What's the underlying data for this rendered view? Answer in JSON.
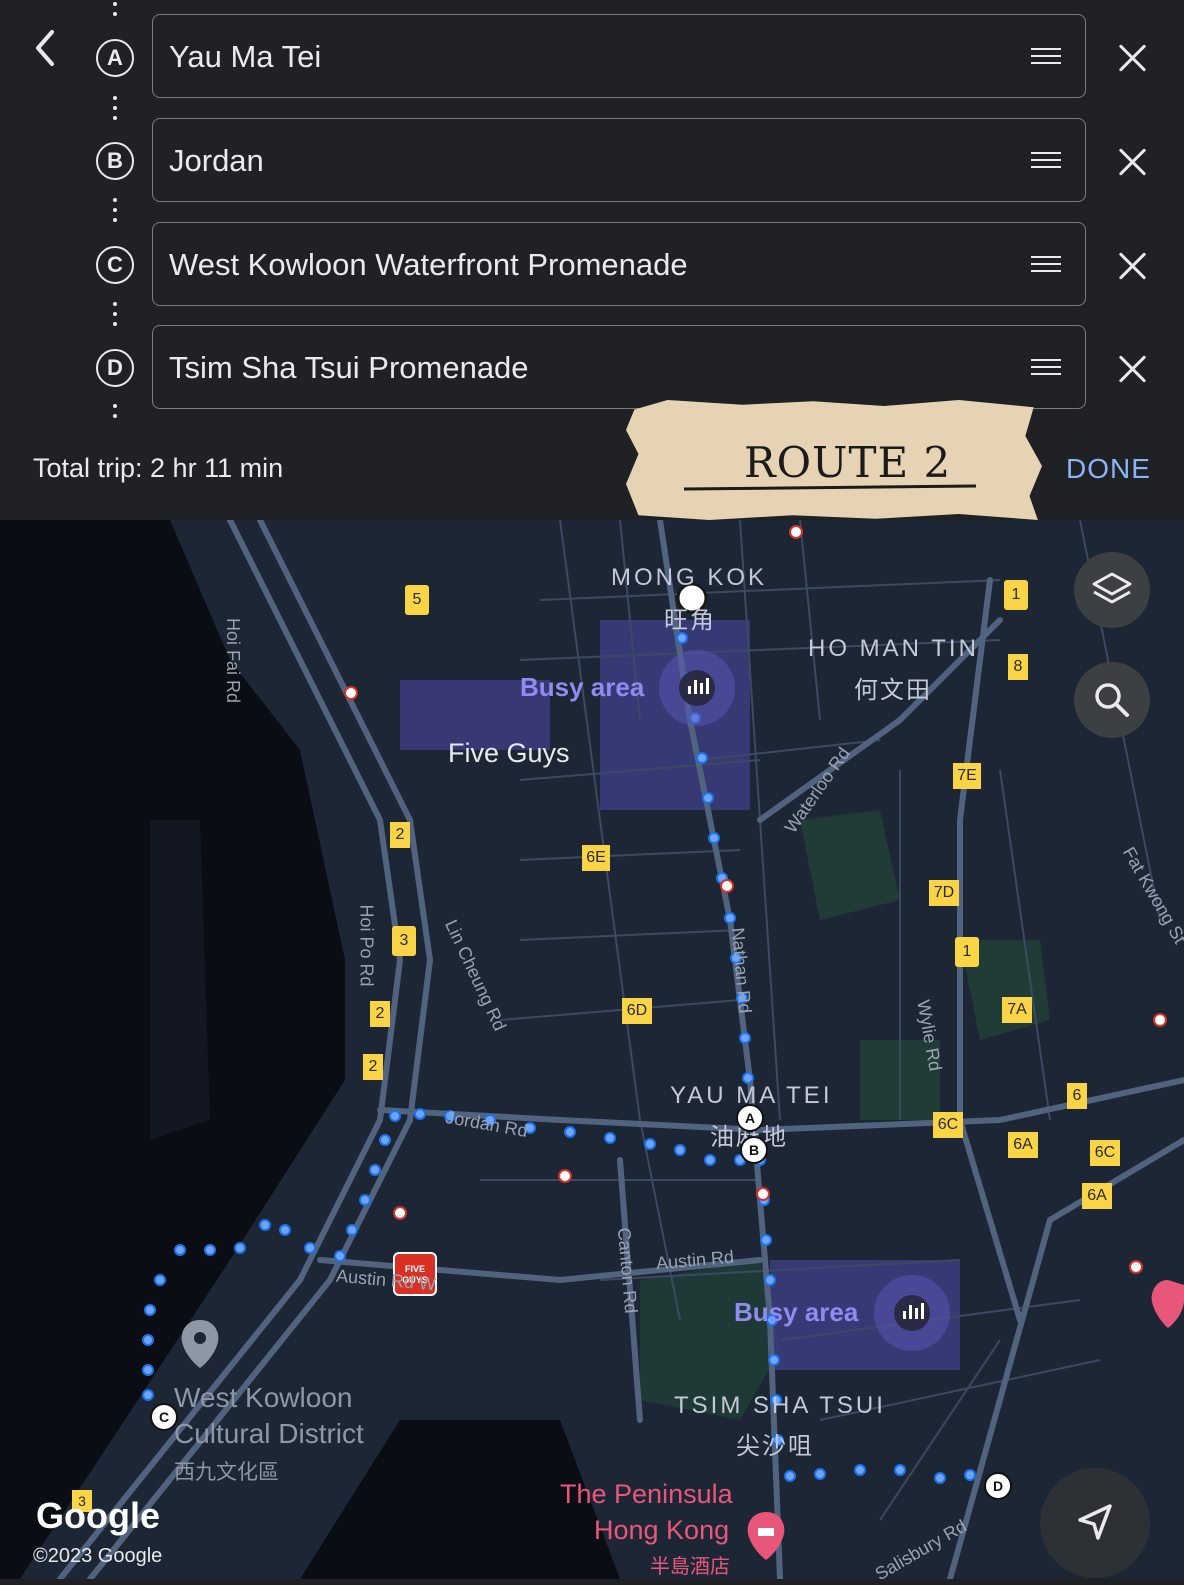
{
  "header": {
    "back_label": "<",
    "stops": [
      {
        "letter": "A",
        "value": "Yau Ma Tei"
      },
      {
        "letter": "B",
        "value": "Jordan"
      },
      {
        "letter": "C",
        "value": "West Kowloon Waterfront Promenade"
      },
      {
        "letter": "D",
        "value": "Tsim Sha Tsui Promenade"
      }
    ],
    "total_trip": "Total trip: 2 hr 11 min",
    "done_label": "DONE"
  },
  "overlay": {
    "tape_text": "ROUTE 2"
  },
  "map": {
    "districts": {
      "mong_kok": "MONG KOK",
      "mong_kok_zh": "旺角",
      "ho_man_tin": "HO MAN TIN",
      "ho_man_tin_zh": "何文田",
      "yau_ma_tei": "YAU MA TEI",
      "yau_ma_tei_zh": "油麻地",
      "tsim_sha_tsui": "TSIM SHA TSUI",
      "tsim_sha_tsui_zh": "尖沙咀"
    },
    "busy_area_1": "Busy area",
    "busy_area_2": "Busy area",
    "five_guys": "Five Guys",
    "five_guys_logo": "FIVE GUYS",
    "west_kowloon": "West Kowloon",
    "cultural_district": "Cultural District",
    "west_kowloon_zh": "西九文化區",
    "peninsula_1": "The Peninsula",
    "peninsula_2": "Hong Kong",
    "peninsula_zh": "半島酒店",
    "roads": {
      "hoi_fai": "Hoi Fai Rd",
      "hoi_po": "Hoi Po Rd",
      "lin_cheung": "Lin Cheung Rd",
      "nathan": "Nathan Rd",
      "jordan": "Jordan Rd",
      "austin": "Austin Rd",
      "austin_w": "Austin Rd W",
      "canton": "Canton Rd",
      "waterloo": "Waterloo Rd",
      "wylie": "Wylie Rd",
      "fat_kwong": "Fat Kwong St",
      "salisbury": "Salisbury Rd"
    },
    "route_badges": [
      "5",
      "1",
      "8",
      "7E",
      "2",
      "6E",
      "7D",
      "3",
      "1",
      "6D",
      "2",
      "2",
      "7A",
      "6",
      "6C",
      "6A",
      "6C",
      "6A",
      "3"
    ],
    "waypoints": {
      "a": "A",
      "b": "B",
      "c": "C",
      "d": "D"
    },
    "google": "Google",
    "copyright": "©2023 Google",
    "icons": {
      "layers": "layers-icon",
      "search": "search-icon",
      "navigate": "navigate-arrow-icon"
    },
    "colors": {
      "route": "#4c8df6",
      "busy": "#7b6fe0",
      "pin_red": "#e8577a"
    }
  }
}
